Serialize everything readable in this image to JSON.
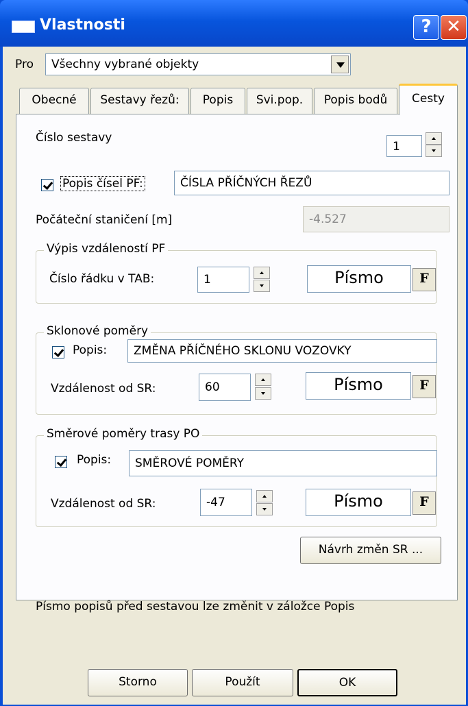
{
  "window": {
    "title": "Vlastnosti",
    "help_label": "?",
    "close_label": "✕"
  },
  "pro": {
    "label": "Pro",
    "value": "Všechny vybrané objekty"
  },
  "tabs": [
    {
      "label": "Obecné"
    },
    {
      "label": "Sestavy řezů:"
    },
    {
      "label": "Popis"
    },
    {
      "label": "Svi.pop."
    },
    {
      "label": "Popis bodů"
    },
    {
      "label": "Cesty"
    }
  ],
  "panel": {
    "cislo_sestavy": {
      "label": "Číslo sestavy",
      "value": "1"
    },
    "popis_cisel": {
      "label": "Popis čísel PF:",
      "value": "ČÍSLA PŘÍČNÝCH ŘEZŮ",
      "checked": true
    },
    "pocatecni": {
      "label": "Počáteční staničení [m]",
      "value": "-4.527"
    },
    "vypis": {
      "title": "Výpis vzdáleností PF",
      "label": "Číslo řádku v TAB:",
      "value": "1",
      "font_label": "Písmo",
      "font_button": "F"
    },
    "sklonove": {
      "title": "Sklonové poměry",
      "popis_label": "Popis:",
      "popis_value": "ZMĚNA PŘÍČNÉHO SKLONU VOZOVKY",
      "checked": true,
      "vzd_label": "Vzdálenost od SR:",
      "vzd_value": "60",
      "font_label": "Písmo",
      "font_button": "F"
    },
    "smerove": {
      "title": "Směrové poměry trasy PO",
      "popis_label": "Popis:",
      "popis_value": "SMĚROVÉ POMĚRY",
      "checked": true,
      "vzd_label": "Vzdálenost od SR:",
      "vzd_value": "-47",
      "font_label": "Písmo",
      "font_button": "F"
    },
    "navrh_button": "Návrh změn SR ...",
    "note": "Písmo popisů před sestavou lze změnit v záložce Popis"
  },
  "buttons": {
    "storno": "Storno",
    "pouzit": "Použít",
    "ok": "OK"
  }
}
